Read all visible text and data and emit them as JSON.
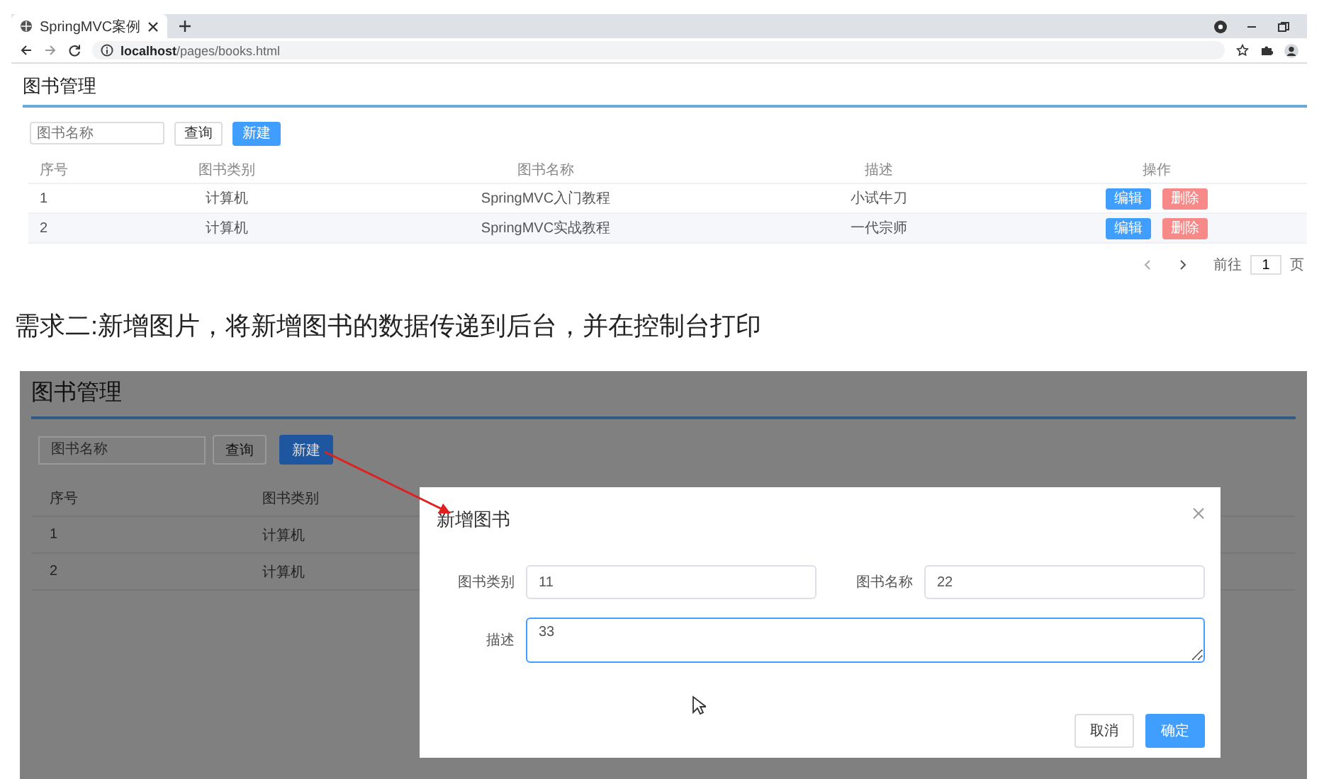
{
  "browser": {
    "tab_title": "SpringMVC案例",
    "address_host": "localhost",
    "address_path": "/pages/books.html"
  },
  "first_screenshot": {
    "title": "图书管理",
    "search": {
      "placeholder": "图书名称"
    },
    "buttons": [
      {
        "label": "查询",
        "kind": "plain"
      },
      {
        "label": "新建",
        "kind": "primary"
      }
    ],
    "table": {
      "columns": [
        "序号",
        "图书类别",
        "图书名称",
        "描述",
        "操作"
      ],
      "rows": [
        {
          "cells": [
            "1",
            "计算机",
            "SpringMVC入门教程",
            "小试牛刀"
          ],
          "actions": [
            {
              "label": "编辑",
              "kind": "primary"
            },
            {
              "label": "删除",
              "kind": "danger"
            }
          ]
        },
        {
          "cells": [
            "2",
            "计算机",
            "SpringMVC实战教程",
            "一代宗师"
          ],
          "actions": [
            {
              "label": "编辑",
              "kind": "primary"
            },
            {
              "label": "删除",
              "kind": "danger"
            }
          ]
        }
      ]
    },
    "pagination": {
      "goto_label": "前往",
      "page": "1",
      "page_suffix": "页"
    }
  },
  "caption": "需求二:新增图片，将新增图书的数据传递到后台，并在控制台打印",
  "second_screenshot": {
    "title": "图书管理",
    "search": {
      "placeholder": "图书名称"
    },
    "buttons": [
      {
        "label": "查询",
        "kind": "plain"
      },
      {
        "label": "新建",
        "kind": "primary"
      }
    ],
    "table": {
      "columns": [
        "序号",
        "图书类别"
      ],
      "rows": [
        {
          "cells": [
            "1",
            "计算机"
          ]
        },
        {
          "cells": [
            "2",
            "计算机"
          ]
        }
      ]
    },
    "dialog": {
      "title": "新增图书",
      "fields": [
        {
          "label": "图书类别",
          "value": "11",
          "kind": "input",
          "focused": false
        },
        {
          "label": "图书名称",
          "value": "22",
          "kind": "input",
          "focused": false
        },
        {
          "label": "描述",
          "value": "33",
          "kind": "textarea",
          "focused": true
        }
      ],
      "buttons": [
        {
          "label": "取消",
          "kind": "plain"
        },
        {
          "label": "确定",
          "kind": "primary"
        }
      ]
    }
  }
}
